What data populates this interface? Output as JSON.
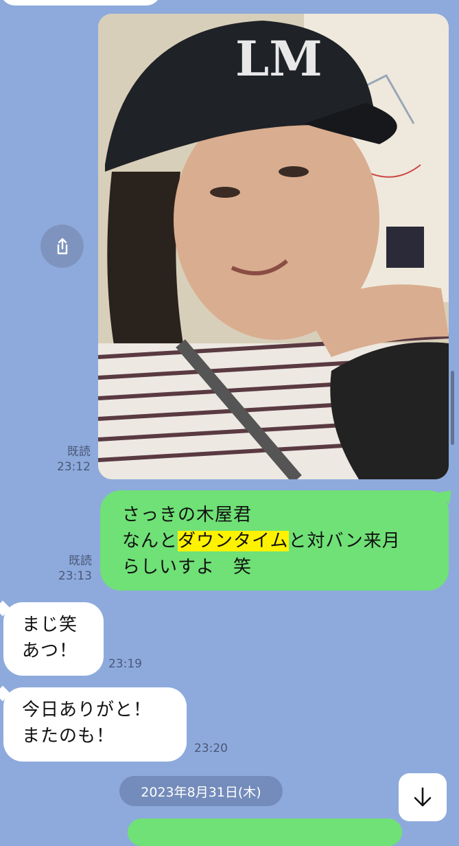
{
  "messages": [
    {
      "type": "image",
      "read_label": "既読",
      "time": "23:12"
    },
    {
      "type": "sent",
      "line1": "さっきの木屋君",
      "line2_pre": "なんと",
      "line2_highlight": "ダウンタイム",
      "line2_post": "と対バン来月",
      "line3": "らしいすよ　笑",
      "read_label": "既読",
      "time": "23:13"
    },
    {
      "type": "received",
      "text": "まじ笑\nあつ！",
      "time": "23:19"
    },
    {
      "type": "received",
      "text": "今日ありがと！\nまたのも！",
      "time": "23:20"
    }
  ],
  "date_separator": "2023年8月31日(木)",
  "icons": {
    "share": "share-icon",
    "scroll_down": "arrow-down-icon"
  },
  "colors": {
    "background": "#8eaadc",
    "sent_bubble": "#6fe176",
    "received_bubble": "#ffffff",
    "highlight": "#fff200"
  }
}
